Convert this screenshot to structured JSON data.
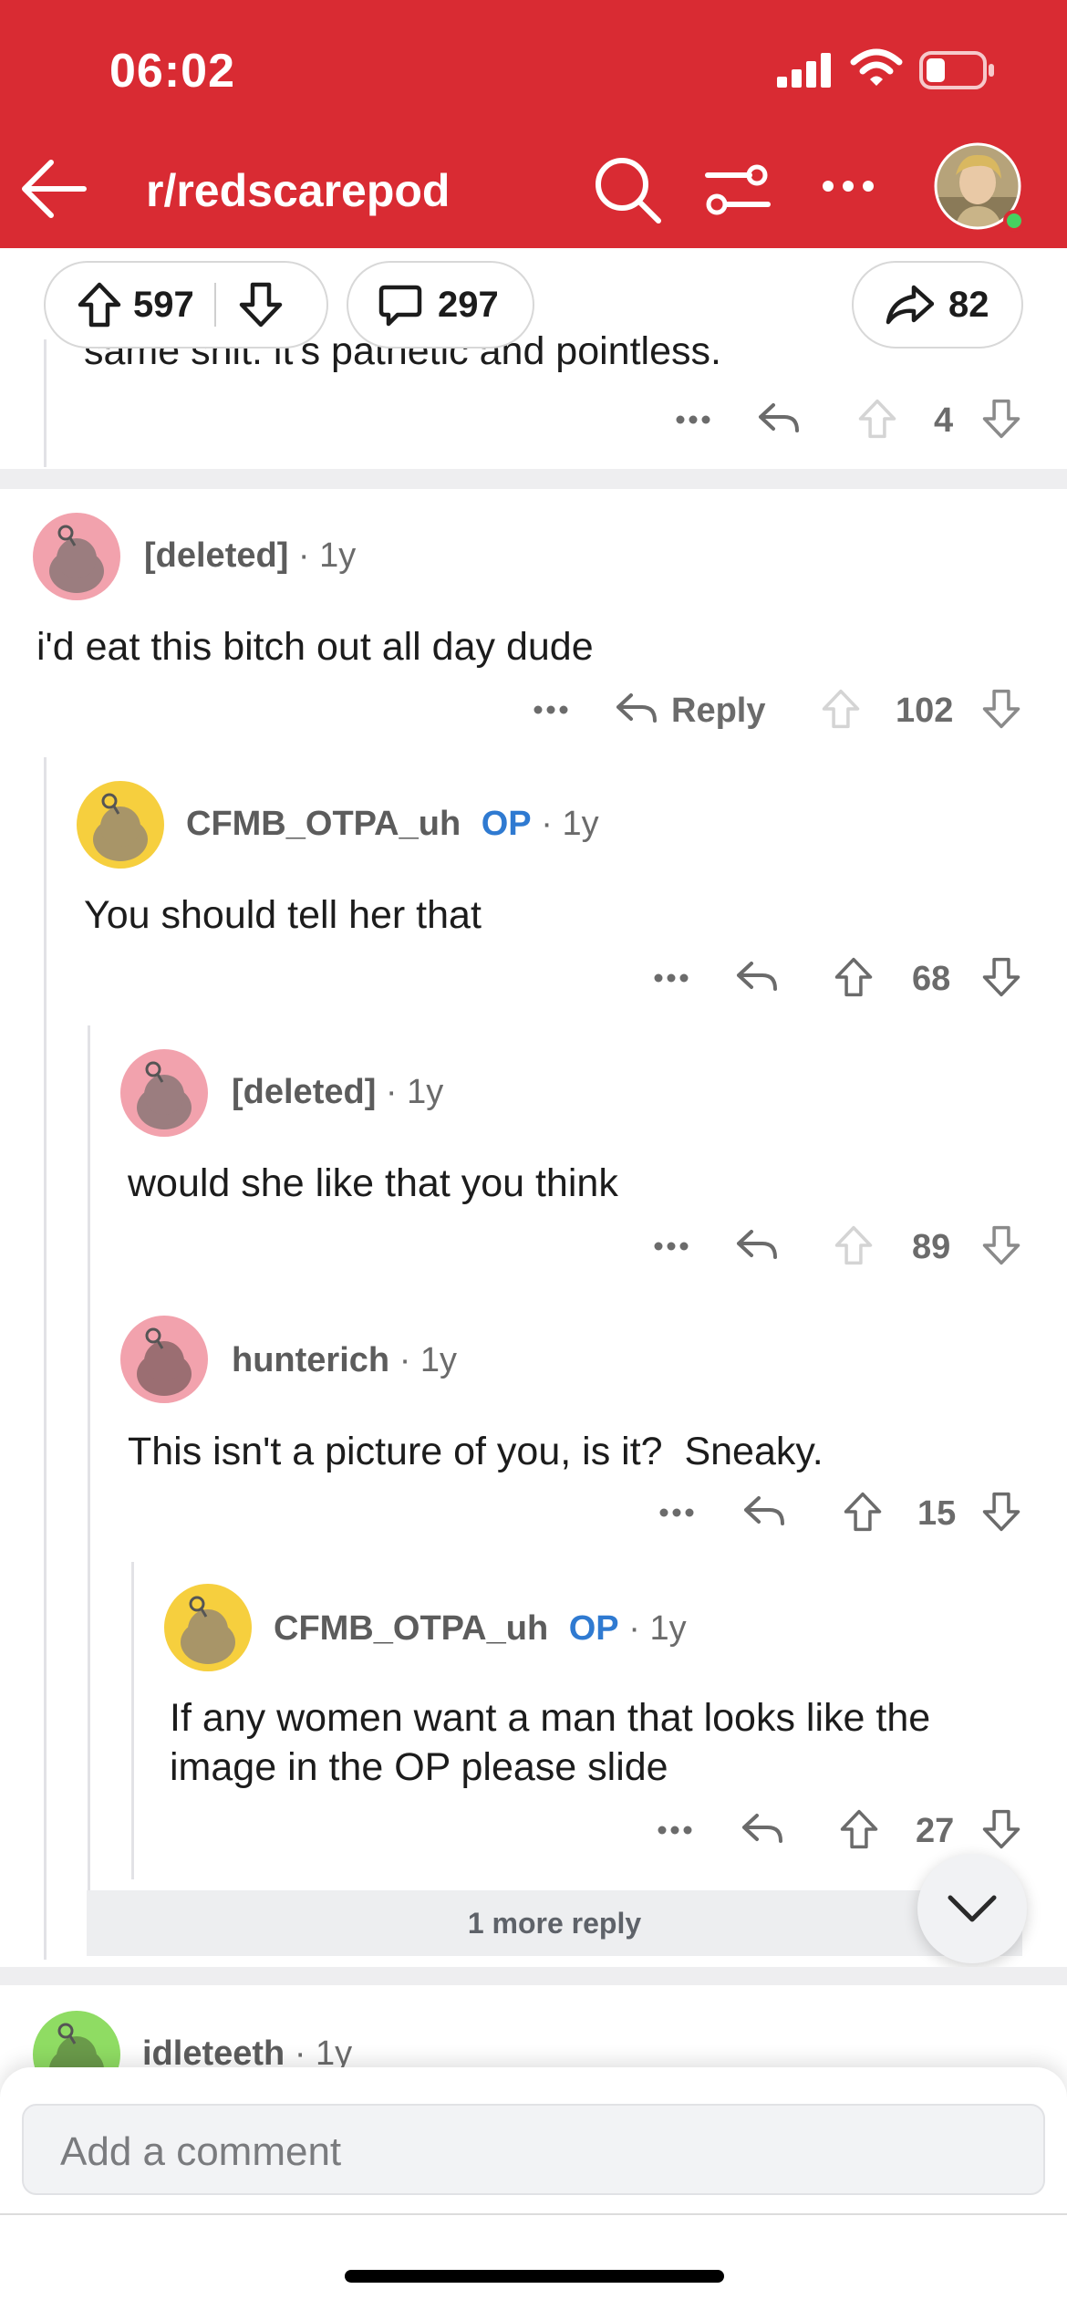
{
  "status_bar": {
    "time": "06:02"
  },
  "header": {
    "subreddit": "r/redscarepod"
  },
  "action_bar": {
    "upvotes": "597",
    "comments": "297",
    "shares": "82"
  },
  "prev_comment": {
    "text_fragment": "same shit. it's pathetic and pointless.",
    "score": "4"
  },
  "comments": [
    {
      "author": "[deleted]",
      "age": "1y",
      "text": "i'd eat this bitch out all day dude",
      "reply_label": "Reply",
      "score": "102",
      "avatar_color": "#f2a2ad"
    },
    {
      "author": "CFMB_OTPA_uh",
      "op_badge": "OP",
      "age": "1y",
      "text": "You should tell her that",
      "score": "68",
      "avatar_color": "#f6cf3e"
    },
    {
      "author": "[deleted]",
      "age": "1y",
      "text": "would she like that you think",
      "score": "89",
      "avatar_color": "#f2a2ad"
    },
    {
      "author": "hunterich",
      "age": "1y",
      "text": "This isn't a picture of you, is it?  Sneaky.",
      "score": "15",
      "avatar_color": "#f2a2ad"
    },
    {
      "author": "CFMB_OTPA_uh",
      "op_badge": "OP",
      "age": "1y",
      "text": "If any women want a man that looks like the image in the OP please slide",
      "score": "27",
      "avatar_color": "#f6cf3e"
    }
  ],
  "more_replies": "1 more reply",
  "next_comment": {
    "author": "idleteeth",
    "age": "1y",
    "avatar_color": "#8fdc63"
  },
  "composer": {
    "placeholder": "Add a comment"
  },
  "colors": {
    "brand_red": "#d92b33",
    "op_blue": "#2f7ad1"
  }
}
